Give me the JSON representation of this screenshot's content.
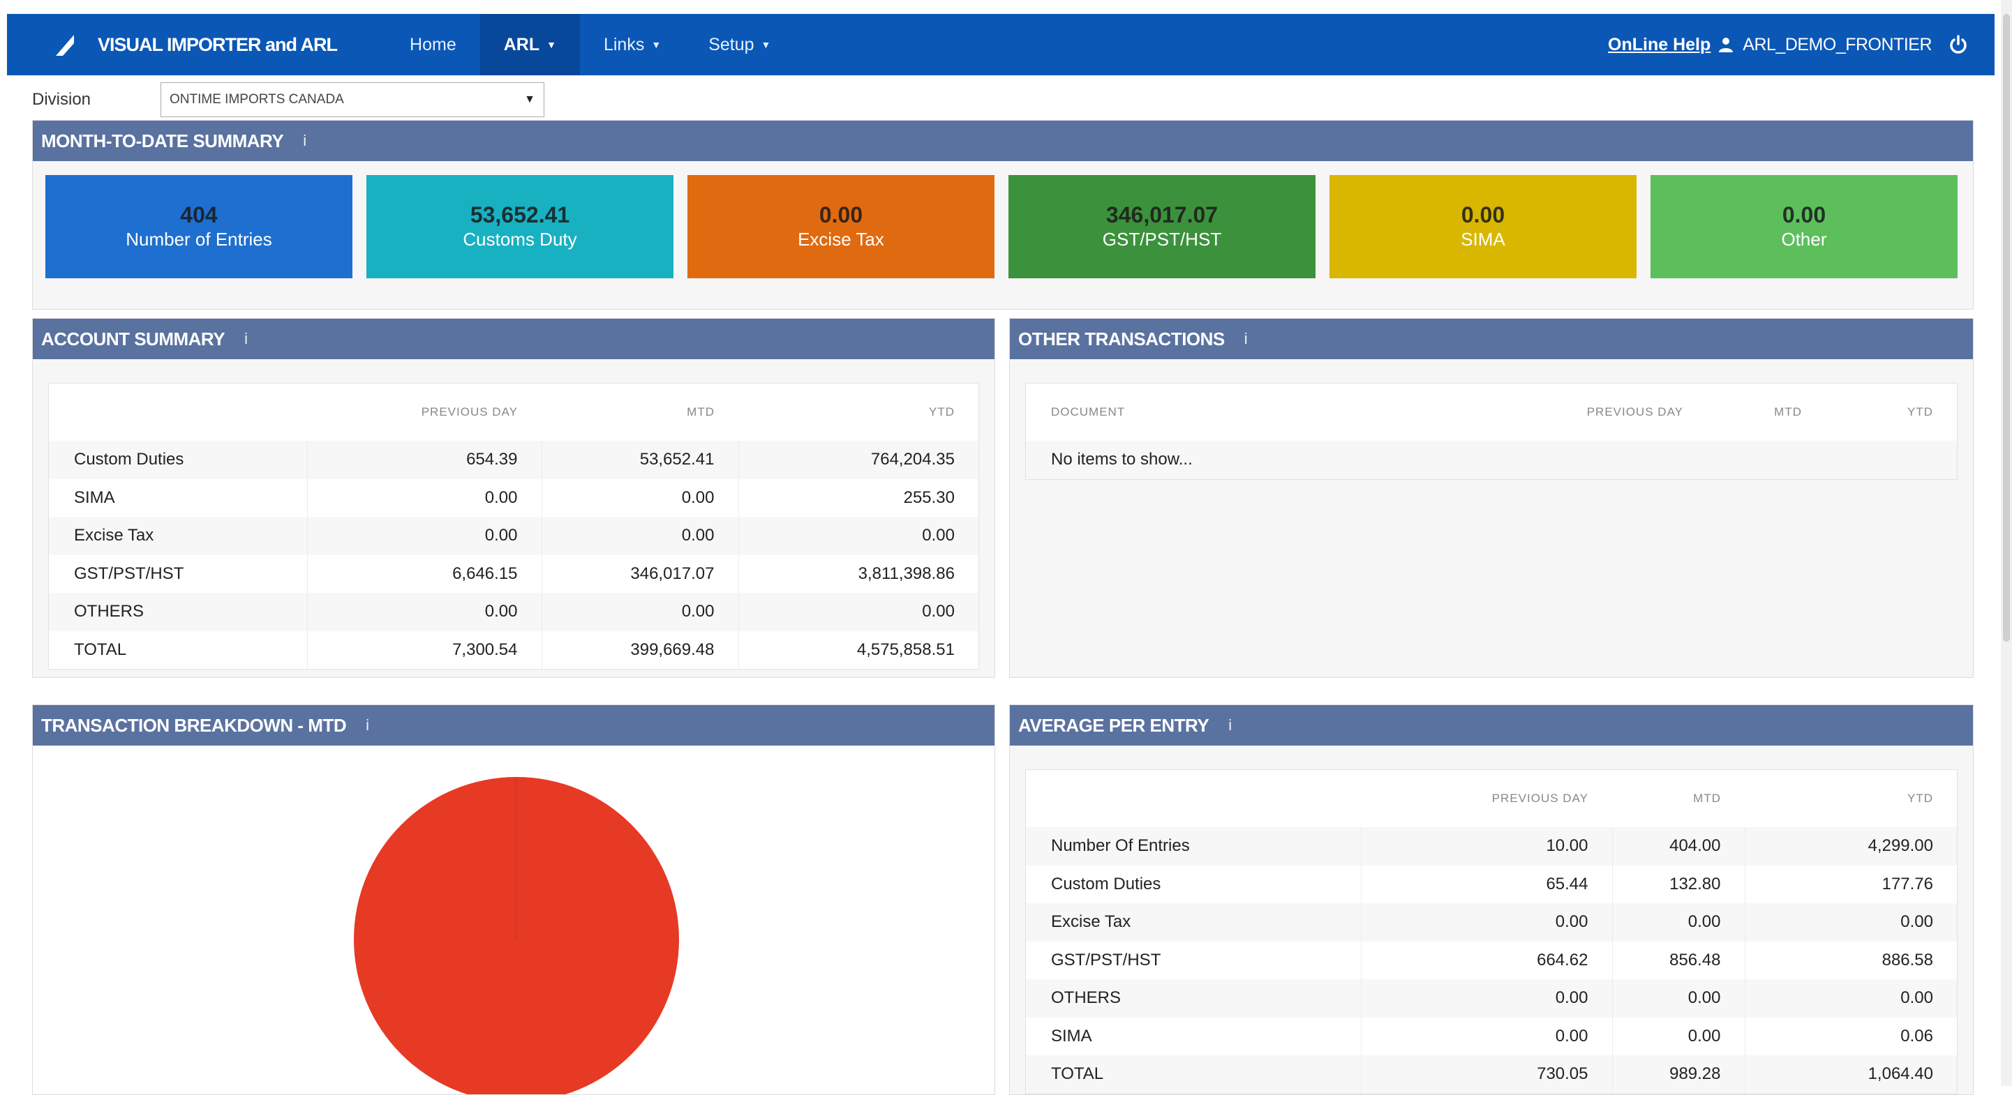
{
  "app": {
    "title": "VISUAL IMPORTER and ARL"
  },
  "nav": [
    {
      "label": "Home",
      "caret": ""
    },
    {
      "label": "ARL",
      "caret": "▼"
    },
    {
      "label": "Links",
      "caret": "▼"
    },
    {
      "label": "Setup",
      "caret": "▼"
    }
  ],
  "topbar": {
    "help": "OnLine Help",
    "user": "ARL_DEMO_FRONTIER"
  },
  "division": {
    "label": "Division",
    "value": "ONTIME IMPORTS CANADA"
  },
  "mtd": {
    "title": "MONTH-TO-DATE SUMMARY",
    "info": "i",
    "tiles": [
      {
        "value": "404",
        "label": "Number of Entries",
        "color": "#1e6fcf"
      },
      {
        "value": "53,652.41",
        "label": "Customs Duty",
        "color": "#18b1c2"
      },
      {
        "value": "0.00",
        "label": "Excise Tax",
        "color": "#e06a10"
      },
      {
        "value": "346,017.07",
        "label": "GST/PST/HST",
        "color": "#3c923c"
      },
      {
        "value": "0.00",
        "label": "SIMA",
        "color": "#d9b700"
      },
      {
        "value": "0.00",
        "label": "Other",
        "color": "#5cbf5c"
      }
    ]
  },
  "account": {
    "title": "ACCOUNT SUMMARY",
    "info": "i",
    "headers": [
      "",
      "PREVIOUS DAY",
      "MTD",
      "YTD"
    ],
    "rows": [
      [
        "Custom Duties",
        "654.39",
        "53,652.41",
        "764,204.35"
      ],
      [
        "SIMA",
        "0.00",
        "0.00",
        "255.30"
      ],
      [
        "Excise Tax",
        "0.00",
        "0.00",
        "0.00"
      ],
      [
        "GST/PST/HST",
        "6,646.15",
        "346,017.07",
        "3,811,398.86"
      ],
      [
        "OTHERS",
        "0.00",
        "0.00",
        "0.00"
      ],
      [
        "TOTAL",
        "7,300.54",
        "399,669.48",
        "4,575,858.51"
      ]
    ]
  },
  "other": {
    "title": "OTHER TRANSACTIONS",
    "info": "i",
    "headers": [
      "DOCUMENT",
      "PREVIOUS DAY",
      "MTD",
      "YTD"
    ],
    "empty": "No items to show..."
  },
  "breakdown": {
    "title": "TRANSACTION BREAKDOWN - MTD",
    "info": "i",
    "color": "#e63a25"
  },
  "average": {
    "title": "AVERAGE PER ENTRY",
    "info": "i",
    "headers": [
      "",
      "PREVIOUS DAY",
      "MTD",
      "YTD"
    ],
    "rows": [
      [
        "Number Of Entries",
        "10.00",
        "404.00",
        "4,299.00"
      ],
      [
        "Custom Duties",
        "65.44",
        "132.80",
        "177.76"
      ],
      [
        "Excise Tax",
        "0.00",
        "0.00",
        "0.00"
      ],
      [
        "GST/PST/HST",
        "664.62",
        "856.48",
        "886.58"
      ],
      [
        "OTHERS",
        "0.00",
        "0.00",
        "0.00"
      ],
      [
        "SIMA",
        "0.00",
        "0.00",
        "0.06"
      ],
      [
        "TOTAL",
        "730.05",
        "989.28",
        "1,064.40"
      ]
    ]
  }
}
